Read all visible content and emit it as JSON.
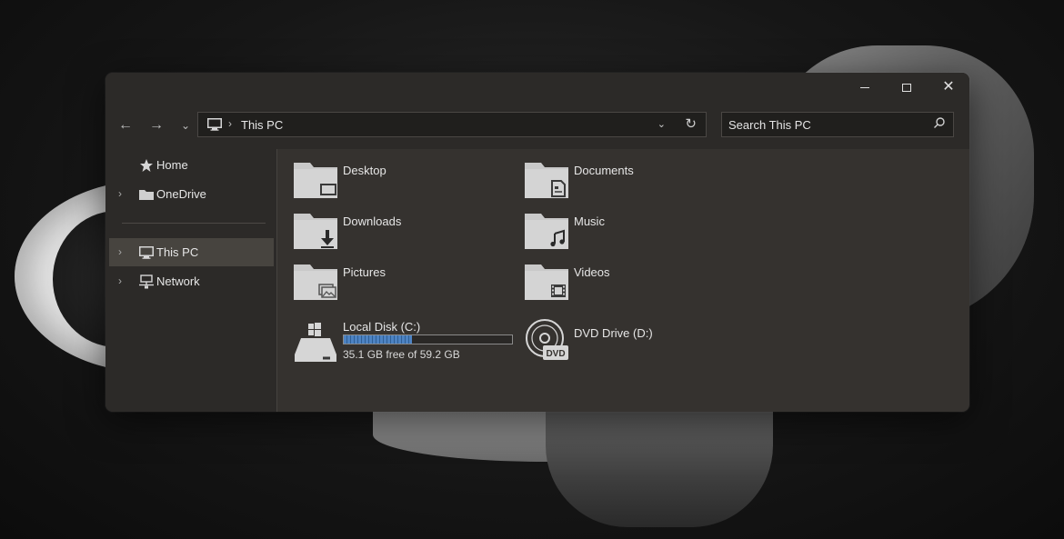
{
  "window": {
    "caption": {
      "minimize": "minimize-icon",
      "maximize": "maximize-icon",
      "close": "✕"
    }
  },
  "toolbar": {
    "back_icon": "←",
    "forward_icon": "→",
    "recent_icon": "⌄",
    "address": {
      "separator": "›",
      "crumb": "This PC",
      "dropdown_icon": "⌄",
      "refresh_icon": "↻"
    },
    "search": {
      "placeholder": "Search This PC"
    }
  },
  "sidebar": {
    "items": [
      {
        "label": "Home",
        "icon": "star-icon",
        "chevron": ""
      },
      {
        "label": "OneDrive",
        "icon": "folder-icon",
        "chevron": "›"
      },
      {
        "label": "This PC",
        "icon": "computer-icon",
        "chevron": "›",
        "selected": true
      },
      {
        "label": "Network",
        "icon": "network-icon",
        "chevron": "›"
      }
    ]
  },
  "folders": [
    {
      "label": "Desktop",
      "icon": "desktop-folder-icon"
    },
    {
      "label": "Documents",
      "icon": "documents-folder-icon"
    },
    {
      "label": "Downloads",
      "icon": "downloads-folder-icon"
    },
    {
      "label": "Music",
      "icon": "music-folder-icon"
    },
    {
      "label": "Pictures",
      "icon": "pictures-folder-icon"
    },
    {
      "label": "Videos",
      "icon": "videos-folder-icon"
    }
  ],
  "drives": [
    {
      "label": "Local Disk (C:)",
      "free_text": "35.1 GB free of 59.2 GB",
      "used_fraction": 0.407,
      "icon": "hard-drive-icon"
    },
    {
      "label": "DVD Drive (D:)",
      "icon": "dvd-drive-icon",
      "badge": "DVD"
    }
  ],
  "colors": {
    "accent": "#4d83c3",
    "window_bg": "#35322f",
    "chrome_bg": "#2c2a28"
  }
}
